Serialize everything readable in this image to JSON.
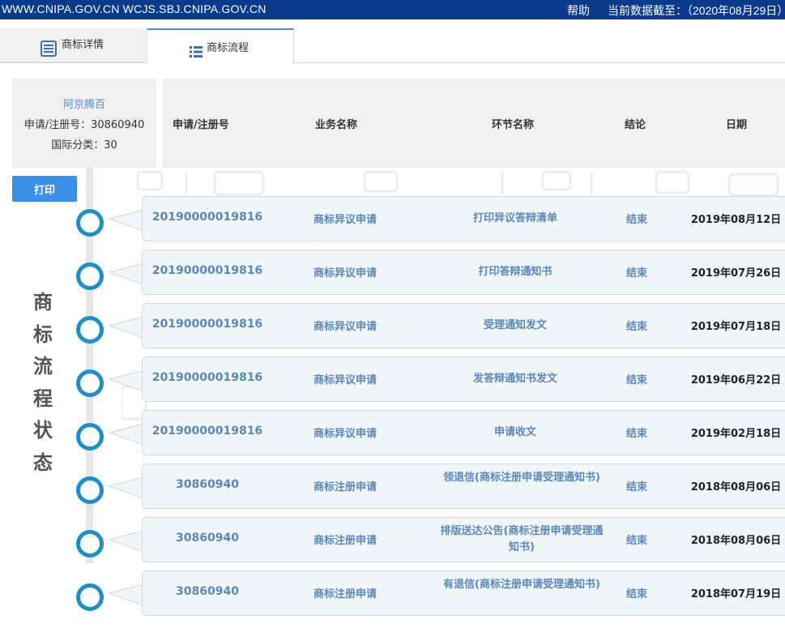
{
  "topbar": {
    "sites": "WWW.CNIPA.GOV.CN WCJS.SBJ.CNIPA.GOV.CN",
    "help": "帮助",
    "as_of": "当前数据截至：（2020年08月29日）"
  },
  "tabs": [
    {
      "label": "商标详情",
      "icon": "document-list-icon",
      "active": false
    },
    {
      "label": "商标流程",
      "icon": "list-icon",
      "active": true
    }
  ],
  "info": {
    "owner": "阿京腾百",
    "reg_no_label": "申请/注册号：30860940",
    "class_label": "国际分类：30"
  },
  "table_header": {
    "number": "申请/注册号",
    "business": "业务名称",
    "step": "环节名称",
    "result": "结论",
    "date": "日期"
  },
  "print_label": "打印",
  "status_title": [
    "商",
    "标",
    "流",
    "程",
    "状",
    "态"
  ],
  "colors": {
    "topbar": "#0a3a8c",
    "node_ring": "#1f8fc8",
    "link_text": "#5b86b8",
    "print_button": "#3b8fe6",
    "card_bg": "#f0f7fb"
  },
  "rows": [
    {
      "number": "20190000019816",
      "business": "商标异议申请",
      "step": "打印异议答辩清单",
      "result": "结束",
      "date": "2019年08月12日"
    },
    {
      "number": "20190000019816",
      "business": "商标异议申请",
      "step": "打印答辩通知书",
      "result": "结束",
      "date": "2019年07月26日"
    },
    {
      "number": "20190000019816",
      "business": "商标异议申请",
      "step": "受理通知发文",
      "result": "结束",
      "date": "2019年07月18日"
    },
    {
      "number": "20190000019816",
      "business": "商标异议申请",
      "step": "发答辩通知书发文",
      "result": "结束",
      "date": "2019年06月22日"
    },
    {
      "number": "20190000019816",
      "business": "商标异议申请",
      "step": "申请收文",
      "result": "结束",
      "date": "2019年02月18日"
    },
    {
      "number": "30860940",
      "business": "商标注册申请",
      "step": "领退信(商标注册申请受理通知书)",
      "result": "结束",
      "date": "2018年08月06日"
    },
    {
      "number": "30860940",
      "business": "商标注册申请",
      "step": "排版送达公告(商标注册申请受理通知书)",
      "result": "结束",
      "date": "2018年08月06日"
    },
    {
      "number": "30860940",
      "business": "商标注册申请",
      "step": "有退信(商标注册申请受理通知书)",
      "result": "结束",
      "date": "2018年07月19日"
    }
  ]
}
